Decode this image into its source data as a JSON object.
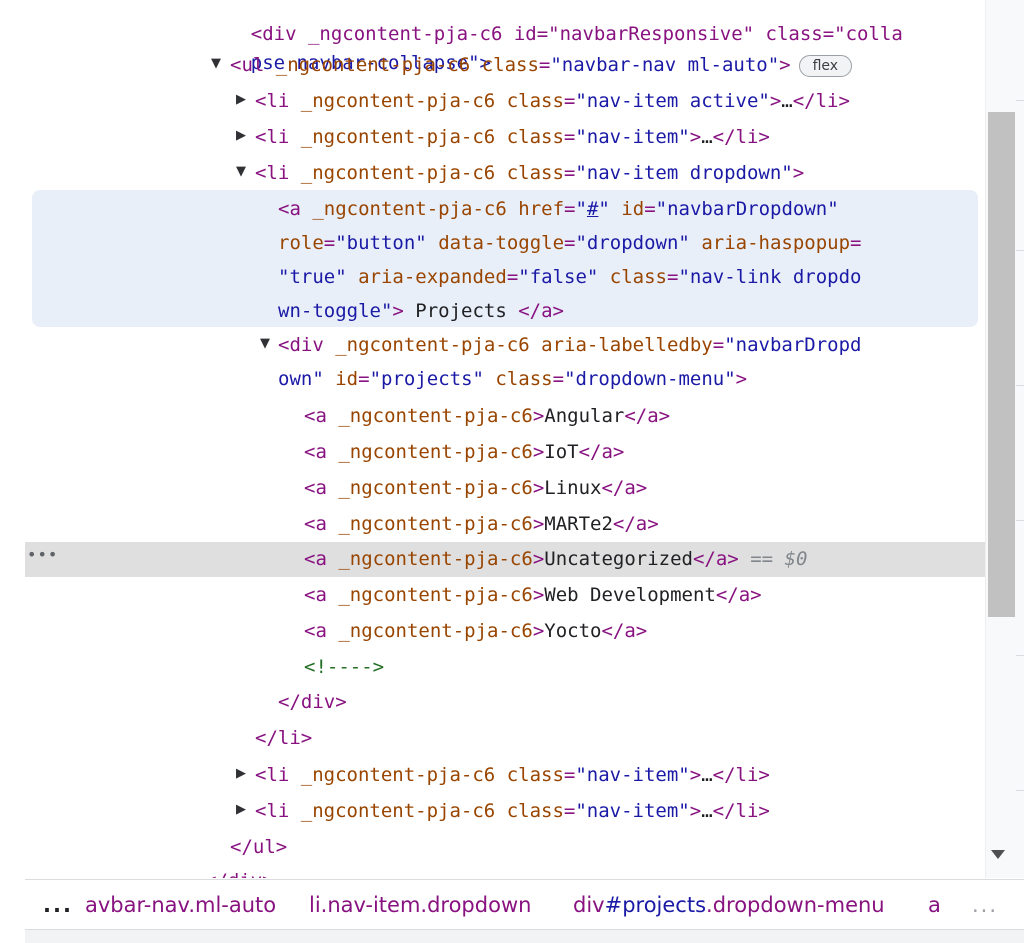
{
  "elements_tree": {
    "cut_top_text": "<div _ngcontent-pja-c6 id=\"navbarResponsive\" class=\"colla",
    "line_collapse": "pse navbar-collapse\">",
    "ul": {
      "open_tag": "<ul",
      "attr_ng": "_ngcontent-pja-c6",
      "class_name": "class",
      "class_value": "\"navbar-nav ml-auto\"",
      "badge": "flex"
    },
    "li_tag": "<li",
    "li_close": "</li>",
    "ng_attr": "_ngcontent-pja-c6",
    "class_attr": "class",
    "collapsed_ellipsis": "…",
    "li_active_class": "\"nav-item active\"",
    "li_class": "\"nav-item\"",
    "li_dropdown_class": "\"nav-item dropdown\"",
    "anchor": {
      "open": "<a",
      "href_attr": "href",
      "href_value": "#",
      "id_attr": "id",
      "id_value": "\"navbarDropdown\"",
      "role_attr": "role",
      "role_value": "\"button\"",
      "toggle_attr": "data-toggle",
      "toggle_value": "\"dropdown\"",
      "haspopup_attr": "aria-haspopup",
      "haspopup_value": "\"true\"",
      "expanded_attr": "aria-expanded",
      "expanded_value": "\"false\"",
      "class_value_part1": "\"nav-link dropdo",
      "class_value_part2": "wn-toggle\"",
      "text": " Projects ",
      "close": "</a>"
    },
    "div": {
      "open": "<div",
      "labelled_attr": "aria-labelledby",
      "labelled_value_part1": "\"navbarDropd",
      "labelled_value_part2": "own\"",
      "id_attr": "id",
      "id_value": "\"projects\"",
      "class_value": "\"dropdown-menu\"",
      "close": "</div>"
    },
    "dropdown_items": [
      "Angular",
      "IoT",
      "Linux",
      "MARTe2",
      "Uncategorized",
      "Web Development",
      "Yocto"
    ],
    "selected_marker": "== $0",
    "comment": "<!---->",
    "ul_close": "</ul>",
    "cut_bottom_text": "</div>"
  },
  "row_dots": "•••",
  "breadcrumbs": {
    "more_left": "...",
    "items": [
      {
        "node": "avbar-nav.ml-auto",
        "id": ""
      },
      {
        "node": "li.nav-item.dropdown",
        "id": ""
      },
      {
        "node": "div",
        "id": "#projects",
        "rest": ".dropdown-menu"
      },
      {
        "node": "a",
        "id": ""
      }
    ],
    "more_right": "..."
  }
}
